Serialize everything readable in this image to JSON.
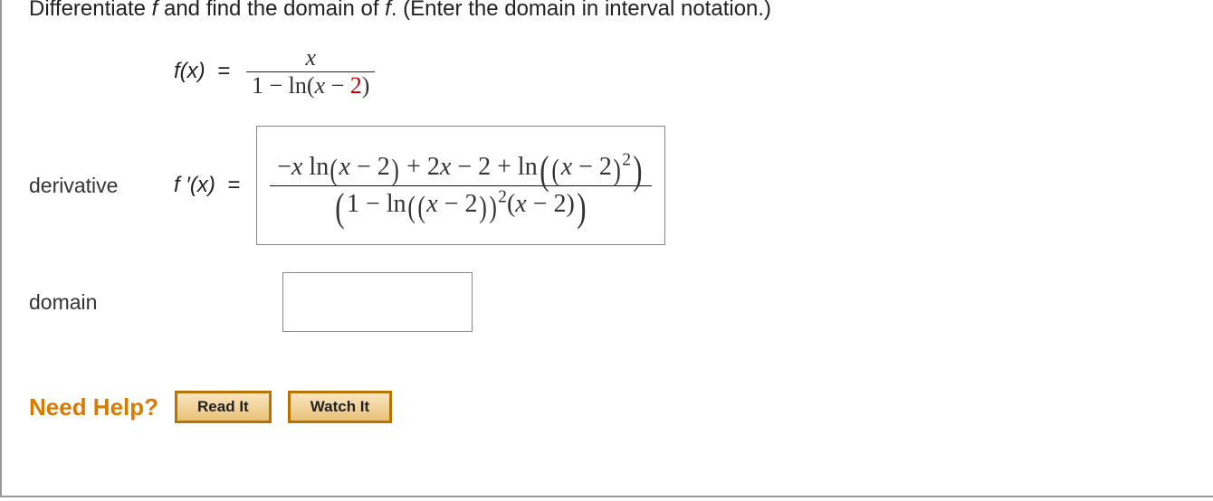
{
  "question": {
    "prefix": "Differentiate ",
    "var1": "f",
    "mid1": " and find the domain of ",
    "var2": "f",
    "suffix": ". (Enter the domain in interval notation.)"
  },
  "fx": {
    "lhs": "f(x) =",
    "num": "x",
    "den_pre": "1 − ln(",
    "den_x": "x",
    "den_minus": " − ",
    "den_two": "2",
    "den_post": ")"
  },
  "derivative": {
    "label": "derivative",
    "lhs": "f ′(x)  =",
    "numerator": "−x ln(x − 2) + 2x − 2 + ln((x − 2)²)",
    "num_p1": "−",
    "num_x1": "x",
    "num_ln1": " ln",
    "num_paren1": "(x − 2)",
    "num_mid": " + 2",
    "num_x2": "x",
    "num_mid2": " − 2 + ln",
    "num_inner": "(x − 2)",
    "num_sq": "2",
    "den_pre": "(1 − ln",
    "den_paren": "(x − 2)",
    "den_close": ")",
    "den_sq": "2",
    "den_tail": "(x − 2)"
  },
  "domain": {
    "label": "domain",
    "value": ""
  },
  "help": {
    "title": "Need Help?",
    "read": "Read It",
    "watch": "Watch It"
  }
}
